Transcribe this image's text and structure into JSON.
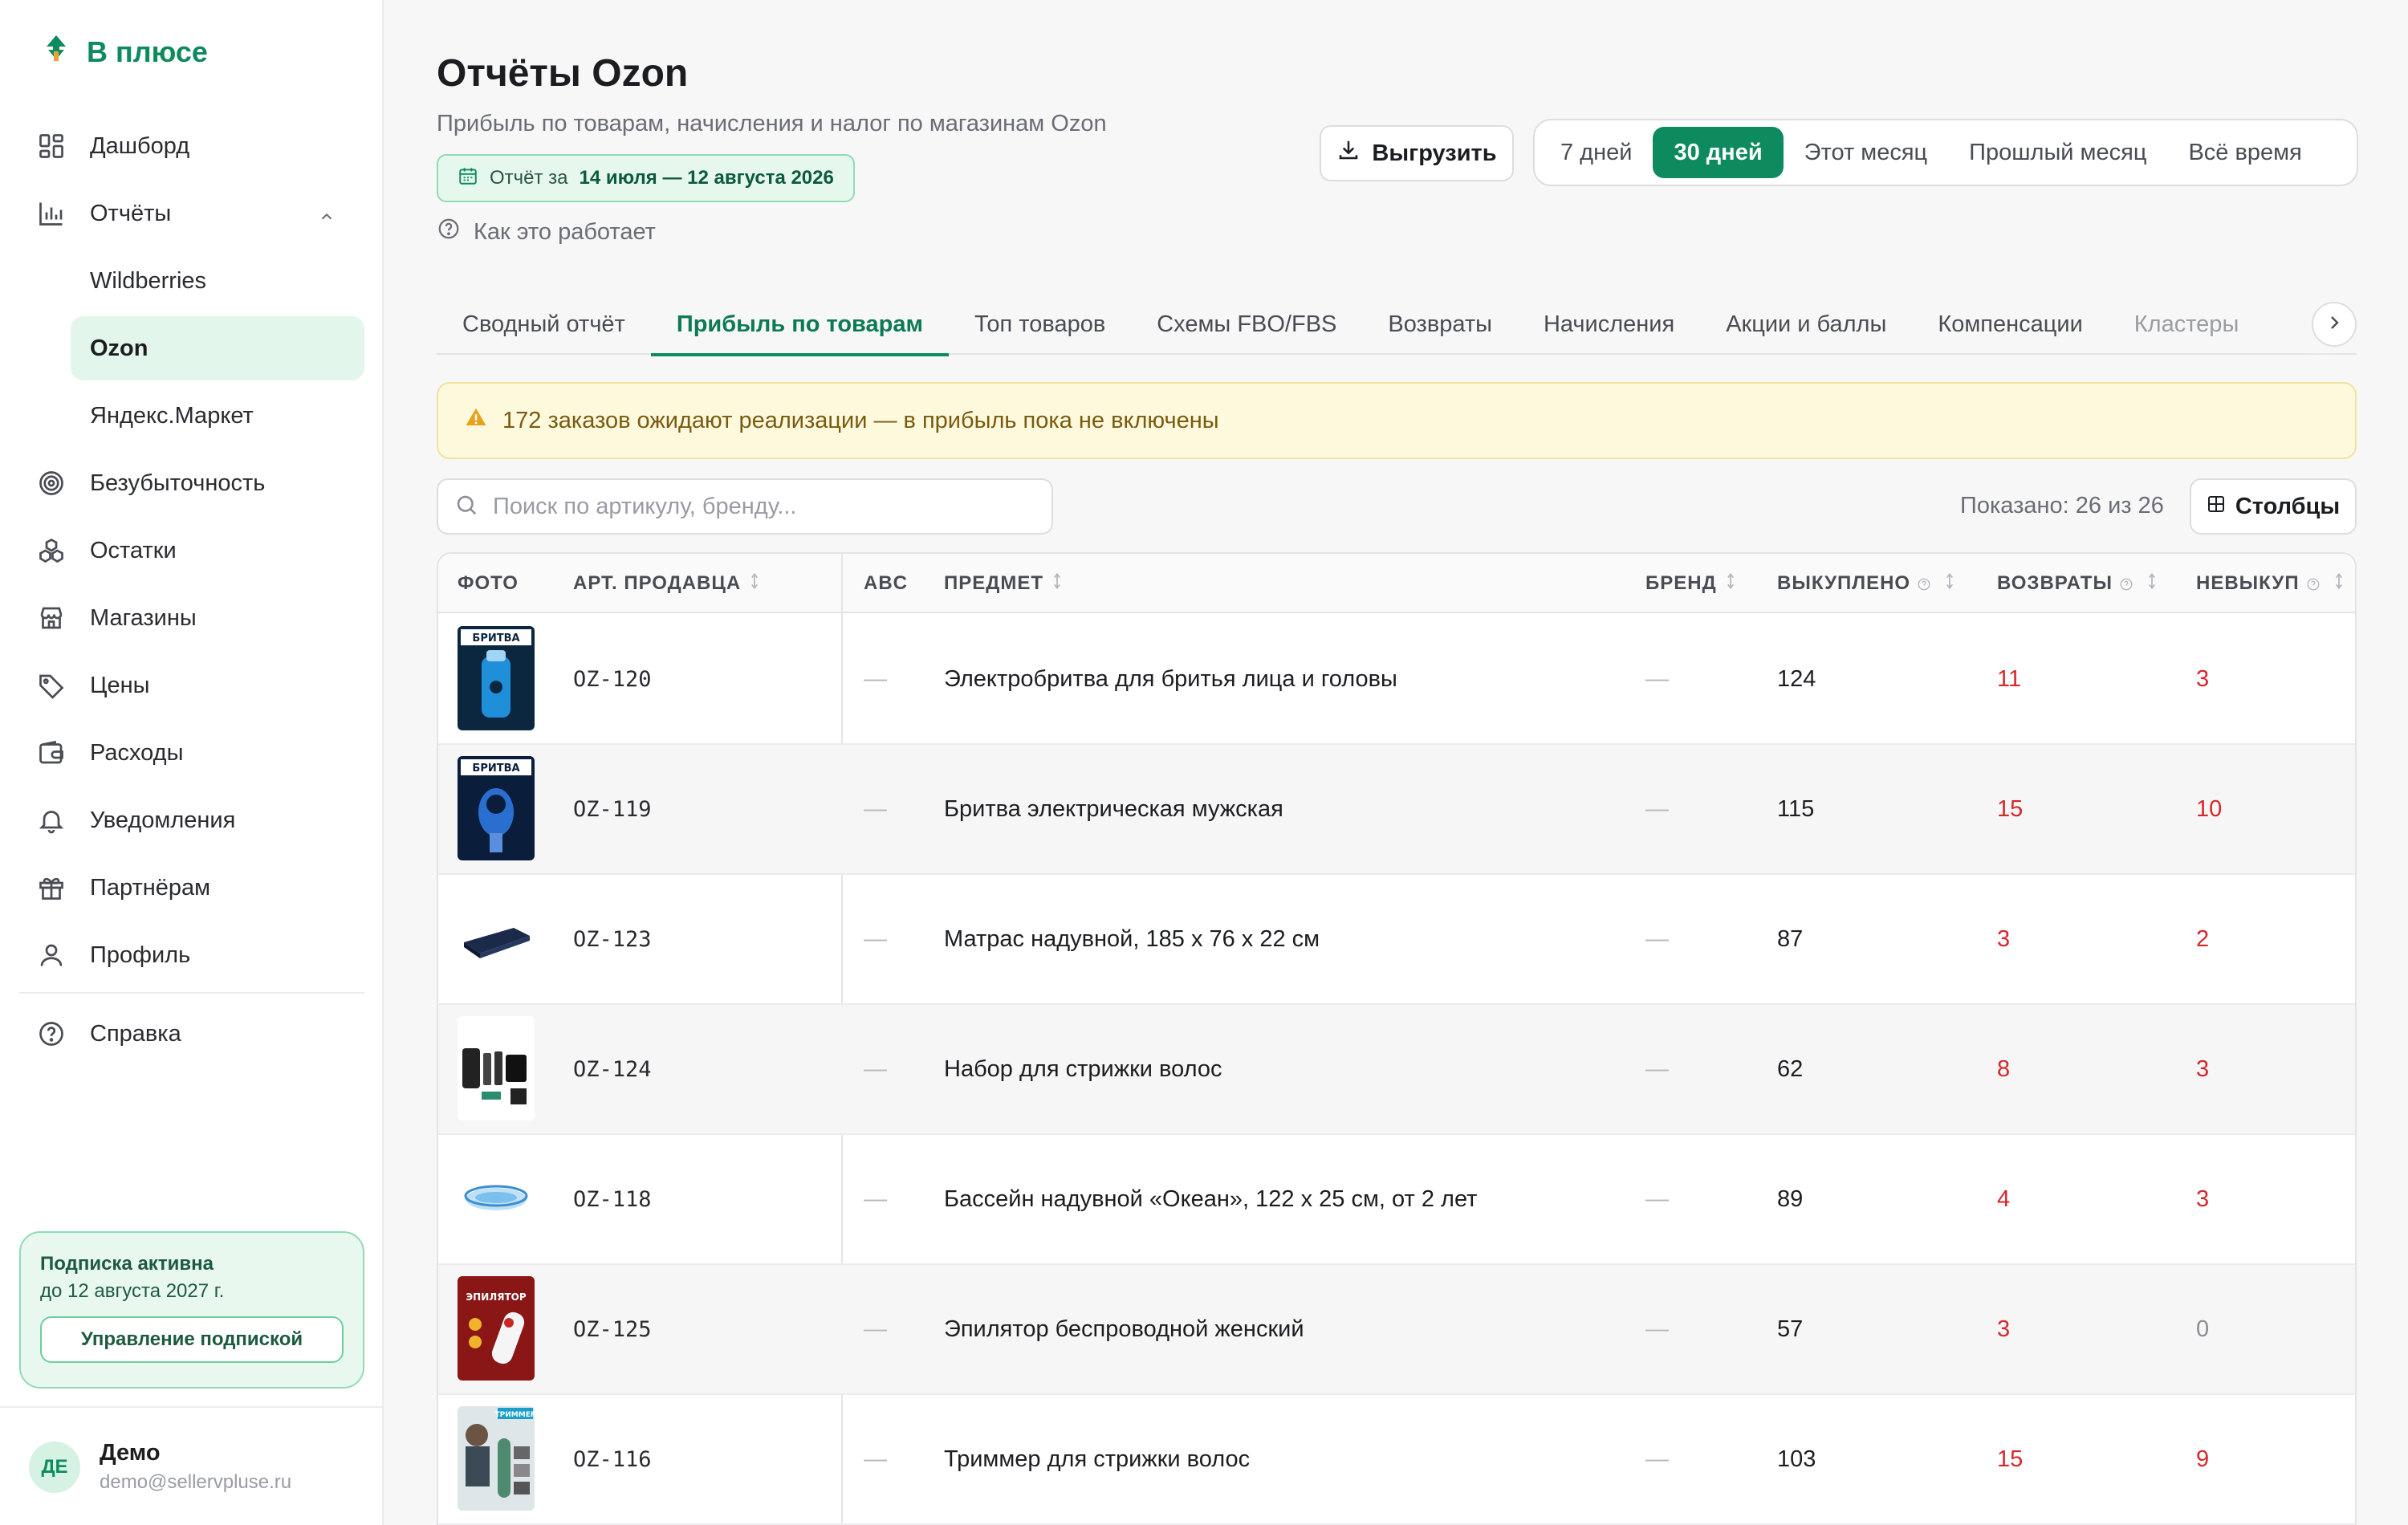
{
  "app": {
    "logo": "В плюсе"
  },
  "sidebar": {
    "items": [
      {
        "label": "Дашборд",
        "icon": "dashboard-icon"
      },
      {
        "label": "Отчёты",
        "icon": "chart-icon",
        "expanded": true
      },
      {
        "label": "Wildberries",
        "sub": true
      },
      {
        "label": "Ozon",
        "sub": true,
        "active": true
      },
      {
        "label": "Яндекс.Маркет",
        "sub": true
      },
      {
        "label": "Безубыточность",
        "icon": "target-icon"
      },
      {
        "label": "Остатки",
        "icon": "boxes-icon"
      },
      {
        "label": "Магазины",
        "icon": "store-icon"
      },
      {
        "label": "Цены",
        "icon": "tag-icon"
      },
      {
        "label": "Расходы",
        "icon": "wallet-icon"
      },
      {
        "label": "Уведомления",
        "icon": "bell-icon"
      },
      {
        "label": "Партнёрам",
        "icon": "gift-icon"
      },
      {
        "label": "Профиль",
        "icon": "user-icon"
      },
      {
        "label": "Справка",
        "icon": "help-icon"
      }
    ],
    "subscription": {
      "title": "Подписка активна",
      "until": "до 12 августа 2027 г.",
      "manage_label": "Управление подпиской"
    },
    "user": {
      "initials": "ДЕ",
      "name": "Демо",
      "email": "demo@sellervpluse.ru"
    }
  },
  "header": {
    "title": "Отчёты Ozon",
    "subtitle": "Прибыль по товарам, начисления и налог по магазинам Ozon",
    "date_prefix": "Отчёт за",
    "date_range": "14 июля — 12 августа 2026",
    "how_it_works": "Как это работает",
    "export_label": "Выгрузить",
    "periods": [
      "7 дней",
      "30 дней",
      "Этот месяц",
      "Прошлый месяц",
      "Всё время"
    ],
    "active_period": "30 дней"
  },
  "tabs": [
    "Сводный отчёт",
    "Прибыль по товарам",
    "Топ товаров",
    "Схемы FBO/FBS",
    "Возвраты",
    "Начисления",
    "Акции и баллы",
    "Компенсации",
    "Кластеры"
  ],
  "active_tab": "Прибыль по товарам",
  "alert": "172 заказов ожидают реализации — в прибыль пока не включены",
  "search": {
    "placeholder": "Поиск по артикулу, бренду...",
    "value": ""
  },
  "shown": "Показано: 26 из 26",
  "columns_label": "Столбцы",
  "table": {
    "headers": {
      "photo": "ФОТО",
      "sku": "АРТ. ПРОДАВЦА",
      "abc": "ABC",
      "subject": "ПРЕДМЕТ",
      "brand": "БРЕНД",
      "bought": "ВЫКУПЛЕНО",
      "returns": "ВОЗВРАТЫ",
      "unbought": "НЕВЫКУП"
    },
    "rows": [
      {
        "sku": "OZ-120",
        "abc": "—",
        "subject": "Электробритва для бритья лица и головы",
        "brand": "—",
        "bought": "124",
        "returns": "11",
        "unbought": "3"
      },
      {
        "sku": "OZ-119",
        "abc": "—",
        "subject": "Бритва электрическая мужская",
        "brand": "—",
        "bought": "115",
        "returns": "15",
        "unbought": "10"
      },
      {
        "sku": "OZ-123",
        "abc": "—",
        "subject": "Матрас надувной, 185 x 76 x 22 см",
        "brand": "—",
        "bought": "87",
        "returns": "3",
        "unbought": "2"
      },
      {
        "sku": "OZ-124",
        "abc": "—",
        "subject": "Набор для стрижки волос",
        "brand": "—",
        "bought": "62",
        "returns": "8",
        "unbought": "3"
      },
      {
        "sku": "OZ-118",
        "abc": "—",
        "subject": "Бассейн надувной «Океан», 122 x 25 см, от 2 лет",
        "brand": "—",
        "bought": "89",
        "returns": "4",
        "unbought": "3"
      },
      {
        "sku": "OZ-125",
        "abc": "—",
        "subject": "Эпилятор беспроводной женский",
        "brand": "—",
        "bought": "57",
        "returns": "3",
        "unbought": "0"
      },
      {
        "sku": "OZ-116",
        "abc": "—",
        "subject": "Триммер для стрижки волос",
        "brand": "—",
        "bought": "103",
        "returns": "15",
        "unbought": "9"
      }
    ],
    "thumb_texts": {
      "r0": "БРИТВА",
      "r1": "БРИТВА",
      "r5": "ЭПИЛЯТОР",
      "r6": "ТРИММЕР"
    }
  },
  "colors": {
    "accent": "#0e8a5f",
    "negative": "#d7262a",
    "warning_bg": "#fdf9dc"
  }
}
